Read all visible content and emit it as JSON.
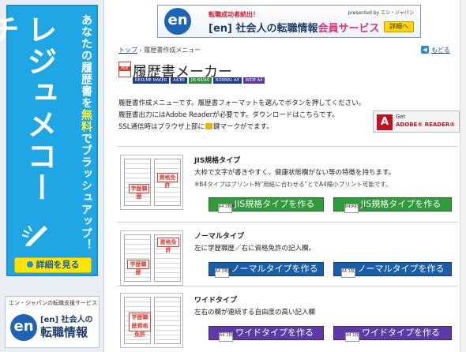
{
  "sidebar": {
    "title": "レジュメコーチ",
    "subtitle_pre": "あなたの履歴書を",
    "subtitle_highlight": "無料",
    "subtitle_post": "でブラッシュアップ！",
    "details_button": "詳細を見る",
    "service_label": "エン・ジャパンの転職支援サービス",
    "service_logo": "en",
    "service_brand": "[en] 社会人の",
    "service_name": "転職情報"
  },
  "banner": {
    "logo": "en",
    "tag": "転職成功者続出！",
    "presented_by": "presented by エン・ジャパン",
    "main": "[en] 社会人の転職情報",
    "service": "会員サービス",
    "button": "詳細へ"
  },
  "breadcrumb": {
    "top": "トップ",
    "separator": "›",
    "current": "履歴書作成メニュー"
  },
  "back_link": "もどる",
  "page": {
    "title": "履歴書メーカー",
    "tags": [
      "RESUME MAKER",
      "A4/B5",
      "JIS B4/A4",
      "NORMAL A4",
      "WIDE A4"
    ]
  },
  "intro": {
    "line1": "履歴書作成メニューです。履歴書フォーマットを選んでボタンを押してください。",
    "line2": "履歴書出力にはAdobe Readerが必要です。ダウンロードはこちらです。",
    "line3_pre": "SSL通信時はブラウザ上部に",
    "line3_post": "鍵マークがでます。"
  },
  "adobe": {
    "get": "Get",
    "reader": "ADOBE® READER®"
  },
  "templates": [
    {
      "title": "JIS規格タイプ",
      "description": "大枠で文字が書きやすく、健康状態欄がない等の特徴を持ちます。",
      "note": "※B4タイプはプリント時\"用紙に合わせる\"とでA4縮小プリント可能です。",
      "box_left": "学歴職歴",
      "box_right": "資格免許",
      "button_left_size": "A4 2枚組",
      "button_left": "JIS規格タイプを作る",
      "button_right_size": "B4(A4) 1枚",
      "button_right": "JIS規格タイプを作る"
    },
    {
      "title": "ノーマルタイプ",
      "description": "左に学歴職歴／右に資格免許の記入欄。",
      "note": "",
      "box_left": "学歴職歴",
      "box_right": "資格免許",
      "button_left_size": "A4 2枚組",
      "button_left": "ノーマルタイプを作る",
      "button_right_size": "A4 1枚",
      "button_right": "ノーマルタイプを作る"
    },
    {
      "title": "ワイドタイプ",
      "description": "左右の欄が連続する自由度の高い記入欄",
      "note": "",
      "box_left": "学歴職歴資格免許",
      "box_right": "",
      "button_left_size": "A4 2枚組",
      "button_left": "ワイドタイプを作る",
      "button_right_size": "A4 1枚",
      "button_right": "ワイドタイプを作る"
    }
  ],
  "colors": {
    "promo_blue": "#1ea7e4",
    "highlight_yellow": "#ffef3a",
    "jis_green": "#2f9b3b",
    "normal_blue": "#1a5ea8",
    "wide_purple": "#5e3aa8",
    "link_blue": "#1a4fa0"
  }
}
